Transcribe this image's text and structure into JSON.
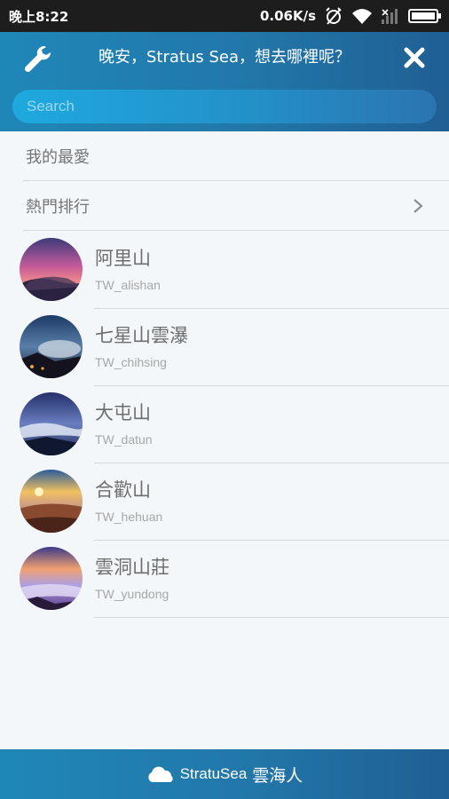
{
  "status_bar": {
    "time": "晚上8:22",
    "network_speed": "0.06K/s",
    "icons": [
      "alarm-off-icon",
      "wifi-icon",
      "signal-icon",
      "battery-icon"
    ]
  },
  "header": {
    "greeting": "晚安，Stratus Sea，想去哪裡呢？",
    "settings_icon": "wrench-icon",
    "close_icon": "close-icon"
  },
  "search": {
    "placeholder": "Search",
    "value": ""
  },
  "menu": [
    {
      "label": "我的最愛"
    },
    {
      "label": "熱門排行"
    }
  ],
  "locations": [
    {
      "title": "阿里山",
      "subtitle": "TW_alishan"
    },
    {
      "title": "七星山雲瀑",
      "subtitle": "TW_chihsing"
    },
    {
      "title": "大屯山",
      "subtitle": "TW_datun"
    },
    {
      "title": "合歡山",
      "subtitle": "TW_hehuan"
    },
    {
      "title": "雲洞山莊",
      "subtitle": "TW_yundong"
    }
  ],
  "footer": {
    "brand_en": "StratuSea",
    "brand_zh": "雲海人",
    "logo_icon": "cloud-logo-icon"
  },
  "colors": {
    "header_blue": "#2277a9",
    "search_blue": "#1ea9df",
    "background": "#f3f7f9"
  }
}
